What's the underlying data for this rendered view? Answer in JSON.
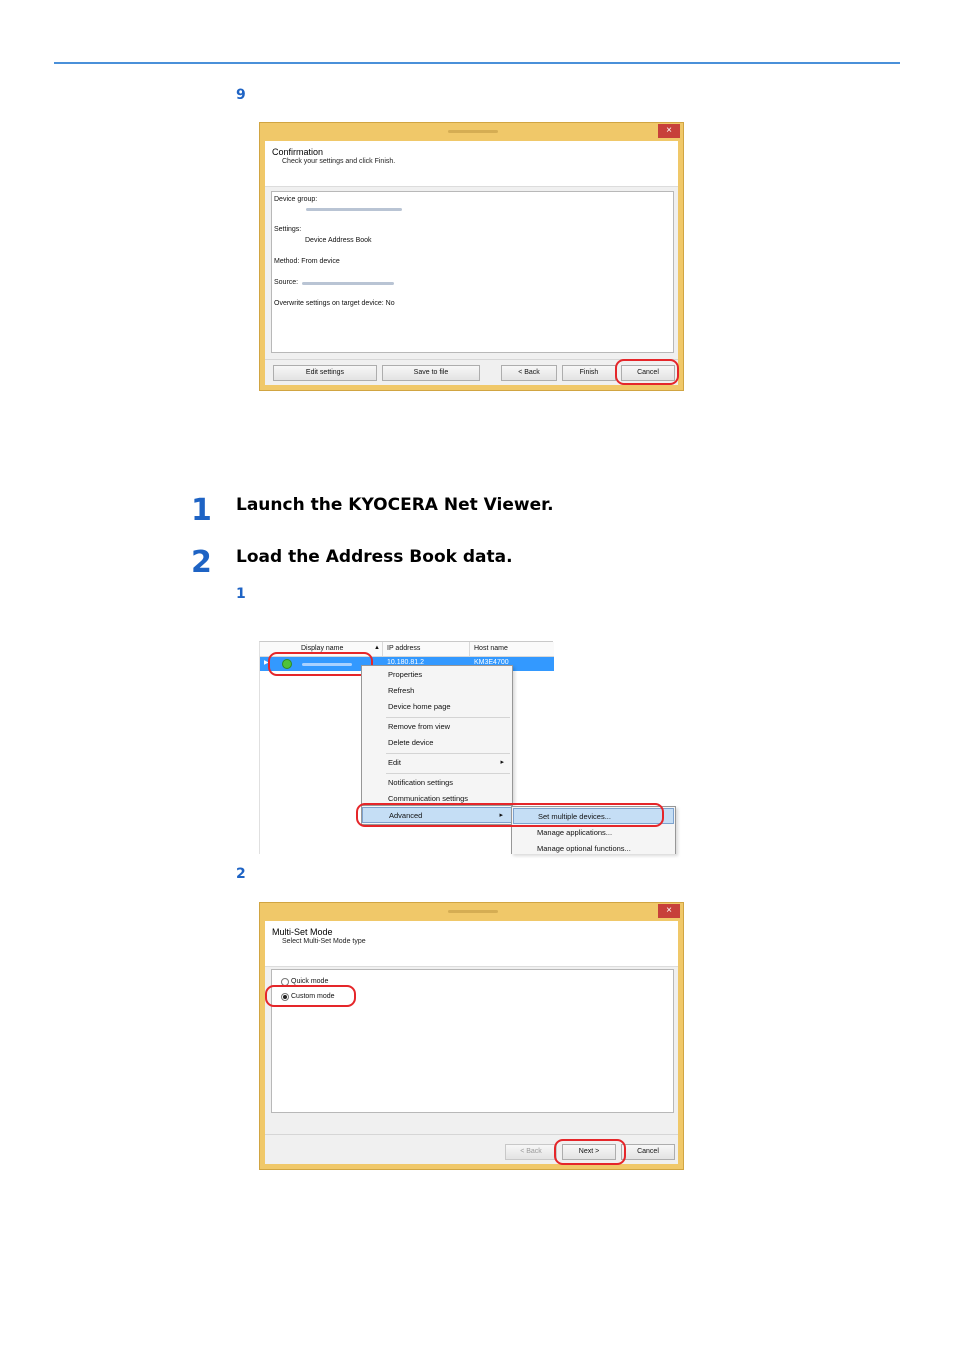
{
  "steps": {
    "sub9": "9",
    "step1_num": "1",
    "step1_text": "Launch the KYOCERA Net Viewer.",
    "step2_num": "2",
    "step2_text": "Load the Address Book data.",
    "sub1": "1",
    "sub2": "2"
  },
  "confirm_dialog": {
    "close": "×",
    "title": "Confirmation",
    "subtitle": "Check your settings and click Finish.",
    "device_group_label": "Device group:",
    "settings_label": "Settings:",
    "settings_value": "Device Address Book",
    "method": "Method: From device",
    "source_label": "Source:",
    "overwrite": "Overwrite settings on target device: No",
    "buttons": {
      "edit_settings": "Edit settings",
      "save_to_file": "Save to file",
      "back": "< Back",
      "finish": "Finish",
      "cancel": "Cancel"
    }
  },
  "net_viewer": {
    "columns": {
      "display_name": "Display name",
      "ip_address": "IP address",
      "host_name": "Host name"
    },
    "row": {
      "ip": "10.180.81.2",
      "host": "KM3E4700"
    },
    "context_menu": {
      "properties": "Properties",
      "refresh": "Refresh",
      "device_home_page": "Device home page",
      "remove_from_view": "Remove from view",
      "delete_device": "Delete device",
      "edit": "Edit",
      "notification_settings": "Notification settings",
      "communication_settings": "Communication settings",
      "advanced": "Advanced",
      "submenu_arrow": "▸"
    },
    "submenu": {
      "set_multiple_devices": "Set multiple devices...",
      "manage_applications": "Manage applications...",
      "manage_optional_functions": "Manage optional functions..."
    }
  },
  "multiset_dialog": {
    "close": "×",
    "title": "Multi-Set Mode",
    "subtitle": "Select Multi-Set Mode type",
    "quick_mode": "Quick mode",
    "custom_mode": "Custom mode",
    "buttons": {
      "back": "< Back",
      "next": "Next >",
      "cancel": "Cancel"
    }
  },
  "colors": {
    "accent_blue": "#1e63c4",
    "rule_blue": "#4a90d9",
    "callout_red": "#e5262a",
    "window_frame": "#f0c869",
    "selection_blue": "#3399ff"
  }
}
